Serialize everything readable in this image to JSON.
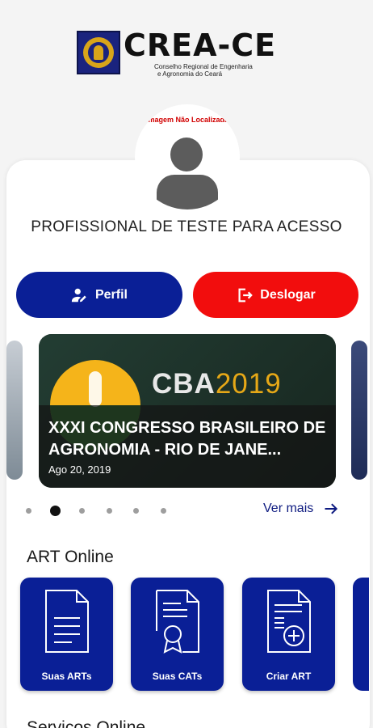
{
  "header": {
    "logo_title": "CREA-CE",
    "logo_subtitle_line1": "Conselho Regional de Engenharia",
    "logo_subtitle_line2": "e Agronomia do Ceará"
  },
  "profile": {
    "avatar_alt_text": "Imagem Não Localizada",
    "name": "PROFISSIONAL DE TESTE PARA ACESSO"
  },
  "actions": {
    "perfil_label": "Perfil",
    "deslogar_label": "Deslogar"
  },
  "news": {
    "slide_brand": "CBA",
    "slide_year": "2019",
    "slide_title": "XXXI CONGRESSO BRASILEIRO DE AGRONOMIA - RIO DE JANE...",
    "slide_date": "Ago 20, 2019",
    "dot_count": 6,
    "active_dot_index": 1,
    "ver_mais_label": "Ver mais"
  },
  "art_online": {
    "section_title": "ART Online",
    "tiles": [
      {
        "label": "Suas ARTs",
        "icon": "document-icon"
      },
      {
        "label": "Suas CATs",
        "icon": "certificate-icon"
      },
      {
        "label": "Criar ART",
        "icon": "add-document-icon"
      }
    ]
  },
  "services": {
    "section_title": "Serviços Online"
  },
  "colors": {
    "primary": "#0a1f96",
    "danger": "#f20d0d",
    "link": "#0d1a80"
  }
}
